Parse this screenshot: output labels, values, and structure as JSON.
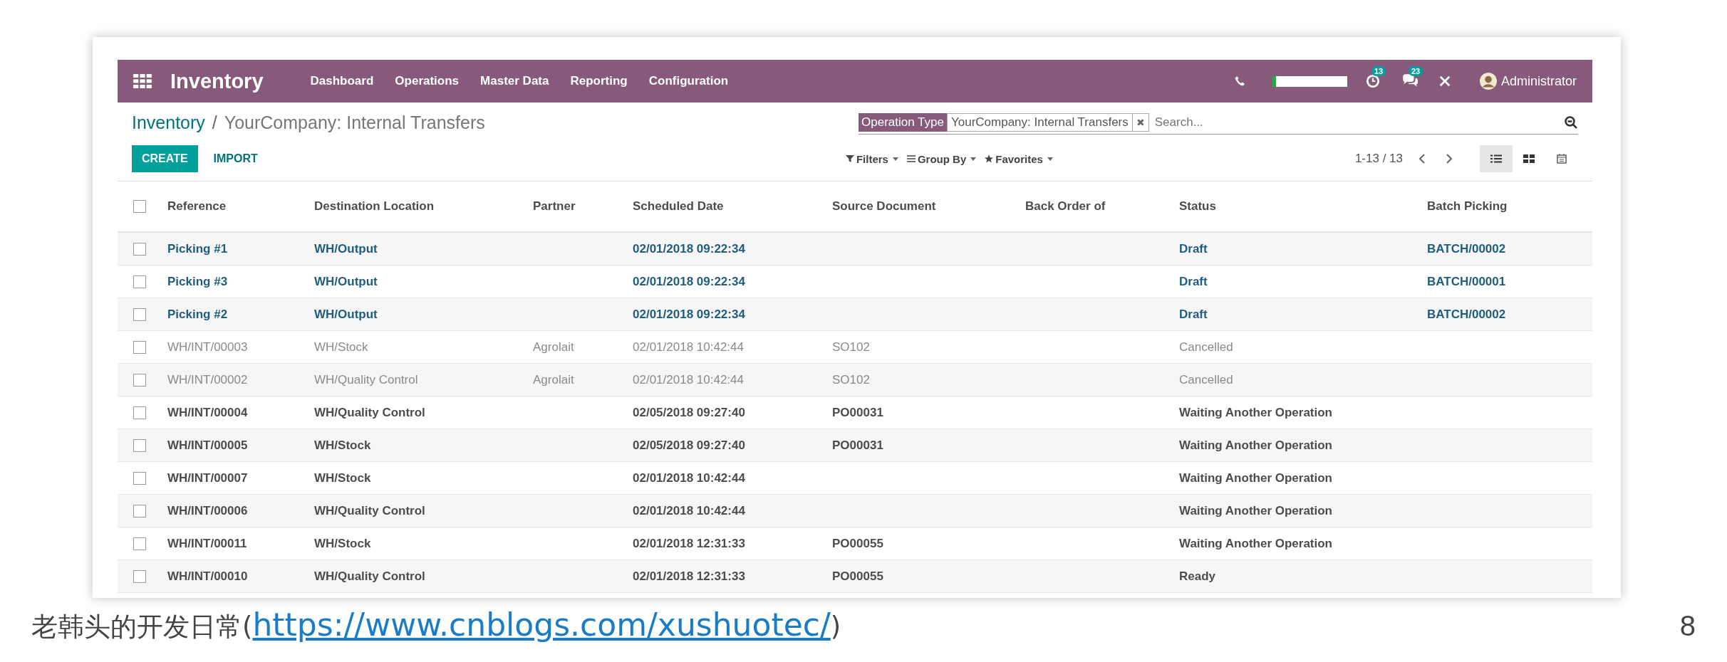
{
  "navbar": {
    "app_title": "Inventory",
    "menu": [
      "Dashboard",
      "Operations",
      "Master Data",
      "Reporting",
      "Configuration"
    ],
    "progress": {
      "level": 0.05
    },
    "activity_badge": "13",
    "messages_badge": "23",
    "user": "Administrator"
  },
  "breadcrumb": {
    "parent": "Inventory",
    "separator": "/",
    "current": "YourCompany: Internal Transfers"
  },
  "search": {
    "facet_label": "Operation Type",
    "facet_value": "YourCompany: Internal Transfers",
    "remove_icon": "✖",
    "placeholder": "Search..."
  },
  "buttons": {
    "create": "CREATE",
    "import": "IMPORT"
  },
  "filters": [
    "Filters",
    "Group By",
    "Favorites"
  ],
  "pager": "1-13 / 13",
  "views": [
    {
      "kind": "list",
      "selected": true
    },
    {
      "kind": "kanban",
      "selected": false
    },
    {
      "kind": "calendar",
      "selected": false
    }
  ],
  "table": {
    "header_checked": false,
    "columns": [
      "Reference",
      "Destination Location",
      "Partner",
      "Scheduled Date",
      "Source Document",
      "Back Order of",
      "Status",
      "Batch Picking"
    ],
    "rows": [
      {
        "kind": "draft",
        "checked": false,
        "cells": [
          "Picking #1",
          "WH/Output",
          "",
          "02/01/2018 09:22:34",
          "",
          "",
          "Draft",
          "BATCH/00002"
        ]
      },
      {
        "kind": "draft",
        "checked": false,
        "cells": [
          "Picking #3",
          "WH/Output",
          "",
          "02/01/2018 09:22:34",
          "",
          "",
          "Draft",
          "BATCH/00001"
        ]
      },
      {
        "kind": "draft",
        "checked": false,
        "cells": [
          "Picking #2",
          "WH/Output",
          "",
          "02/01/2018 09:22:34",
          "",
          "",
          "Draft",
          "BATCH/00002"
        ]
      },
      {
        "kind": "cancelled",
        "checked": false,
        "cells": [
          "WH/INT/00003",
          "WH/Stock",
          "Agrolait",
          "02/01/2018 10:42:44",
          "SO102",
          "",
          "Cancelled",
          ""
        ]
      },
      {
        "kind": "cancelled",
        "checked": false,
        "cells": [
          "WH/INT/00002",
          "WH/Quality Control",
          "Agrolait",
          "02/01/2018 10:42:44",
          "SO102",
          "",
          "Cancelled",
          ""
        ]
      },
      {
        "kind": "normal",
        "checked": false,
        "cells": [
          "WH/INT/00004",
          "WH/Quality Control",
          "",
          "02/05/2018 09:27:40",
          "PO00031",
          "",
          "Waiting Another Operation",
          ""
        ]
      },
      {
        "kind": "normal",
        "checked": false,
        "cells": [
          "WH/INT/00005",
          "WH/Stock",
          "",
          "02/05/2018 09:27:40",
          "PO00031",
          "",
          "Waiting Another Operation",
          ""
        ]
      },
      {
        "kind": "normal",
        "checked": false,
        "cells": [
          "WH/INT/00007",
          "WH/Stock",
          "",
          "02/01/2018 10:42:44",
          "",
          "",
          "Waiting Another Operation",
          ""
        ]
      },
      {
        "kind": "normal",
        "checked": false,
        "cells": [
          "WH/INT/00006",
          "WH/Quality Control",
          "",
          "02/01/2018 10:42:44",
          "",
          "",
          "Waiting Another Operation",
          ""
        ]
      },
      {
        "kind": "normal",
        "checked": false,
        "cells": [
          "WH/INT/00011",
          "WH/Stock",
          "",
          "02/01/2018 12:31:33",
          "PO00055",
          "",
          "Waiting Another Operation",
          ""
        ]
      },
      {
        "kind": "normal",
        "checked": false,
        "cells": [
          "WH/INT/00010",
          "WH/Quality Control",
          "",
          "02/01/2018 12:31:33",
          "PO00055",
          "",
          "Ready",
          ""
        ]
      }
    ]
  },
  "slide": {
    "caption": "老韩头的开发日常(",
    "link": "https://www.cnblogs.com/xushuotec/",
    "caption_end": ")",
    "page_number": "8"
  }
}
